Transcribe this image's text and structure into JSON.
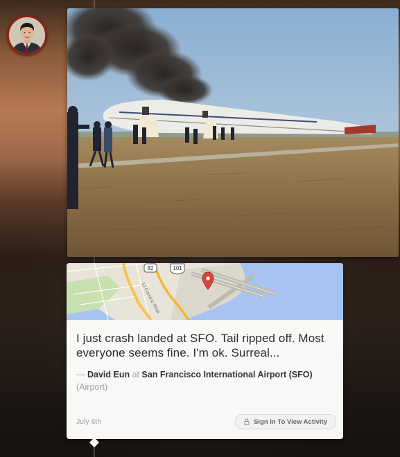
{
  "post": {
    "text": "I just crash landed at SFO. Tail ripped off. Most everyone seems fine. I'm ok. Surreal...",
    "author": "David Eun",
    "at_word": "at",
    "place": "San Francisco International Airport (SFO)",
    "place_type": "(Airport)",
    "date": "July 6th"
  },
  "actions": {
    "activity_label": "Sign In To View Activity"
  },
  "map": {
    "shields": [
      "82",
      "101"
    ],
    "street": "El Camino Real"
  },
  "colors": {
    "avatar_ring": "#8f2118",
    "map_water": "#a7c3f1",
    "map_land": "#e8e4d8",
    "highway": "#f6c44e",
    "pin": "#d9453c"
  }
}
